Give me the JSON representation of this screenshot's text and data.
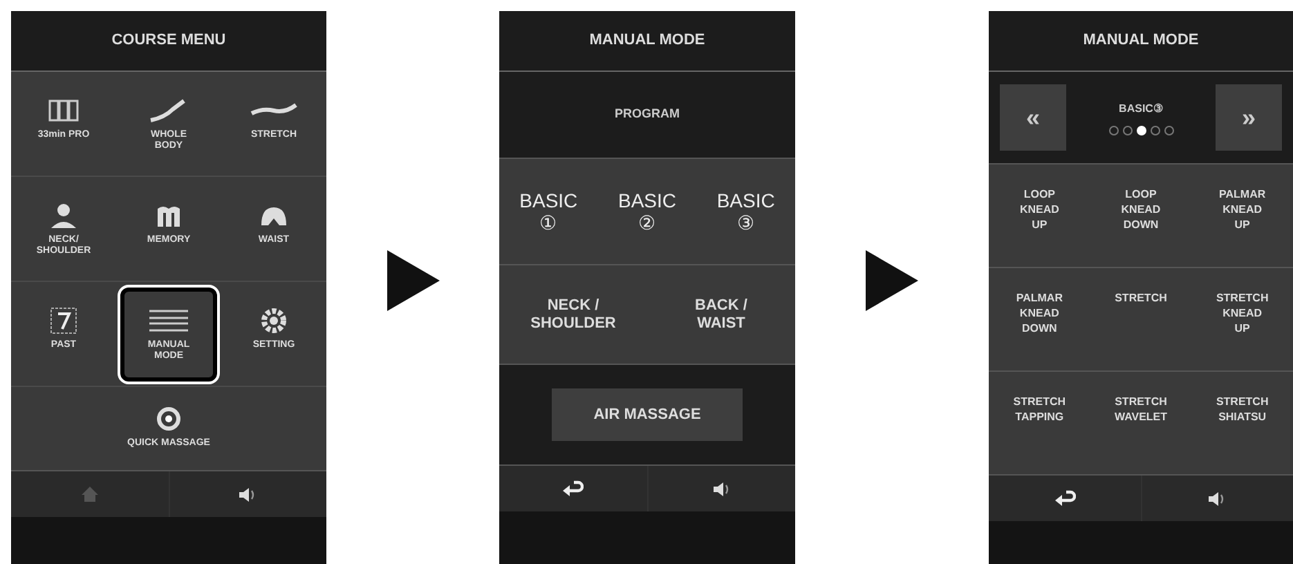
{
  "course_menu": {
    "title": "COURSE MENU",
    "items": [
      {
        "label": "33min PRO",
        "selected": false
      },
      {
        "label": "WHOLE\nBODY",
        "selected": false
      },
      {
        "label": "STRETCH",
        "selected": false
      },
      {
        "label": "NECK/\nSHOULDER",
        "selected": false
      },
      {
        "label": "MEMORY",
        "selected": false
      },
      {
        "label": "WAIST",
        "selected": false
      },
      {
        "label": "PAST",
        "selected": false
      },
      {
        "label": "MANUAL\nMODE",
        "selected": true
      },
      {
        "label": "SETTING",
        "selected": false
      }
    ],
    "quick": {
      "label": "QUICK MASSAGE"
    }
  },
  "manual_mode": {
    "title": "MANUAL MODE",
    "section": "PROGRAM",
    "basics": [
      {
        "label": "BASIC",
        "number": "①"
      },
      {
        "label": "BASIC",
        "number": "②"
      },
      {
        "label": "BASIC",
        "number": "③"
      }
    ],
    "areas": [
      "NECK /\nSHOULDER",
      "BACK /\nWAIST"
    ],
    "air": "AIR MASSAGE"
  },
  "manual_detail": {
    "title": "MANUAL MODE",
    "prev": "«",
    "next": "»",
    "program": "BASIC③",
    "pages": [
      {
        "selected": false
      },
      {
        "selected": false
      },
      {
        "selected": true
      },
      {
        "selected": false
      },
      {
        "selected": false
      }
    ],
    "techniques": [
      "LOOP\nKNEAD\nUP",
      "LOOP\nKNEAD\nDOWN",
      "PALMAR\nKNEAD\nUP",
      "PALMAR\nKNEAD\nDOWN",
      "STRETCH",
      "STRETCH\nKNEAD\nUP",
      "STRETCH\nTAPPING",
      "STRETCH\nWAVELET",
      "STRETCH\nSHIATSU"
    ]
  }
}
